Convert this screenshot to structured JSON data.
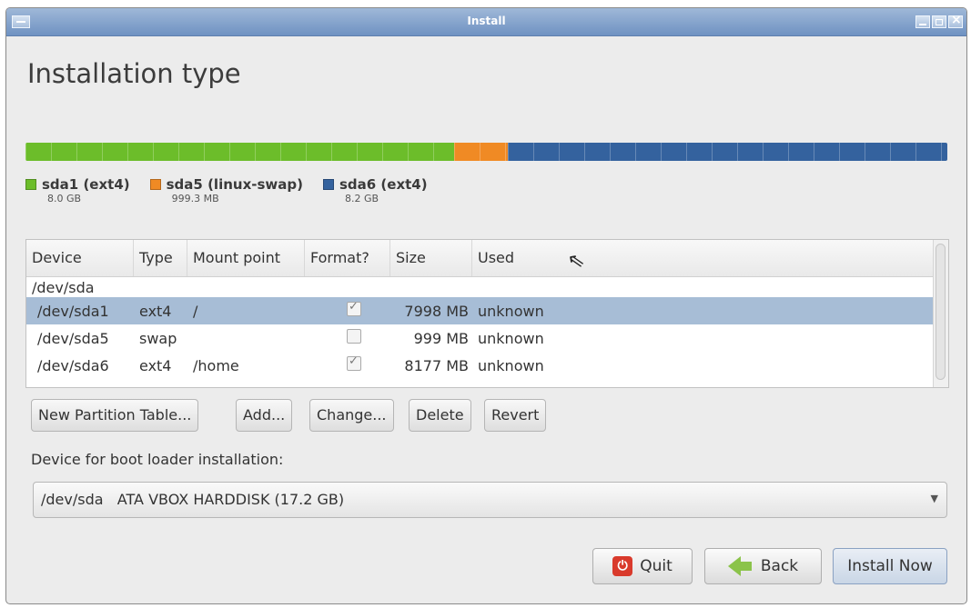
{
  "window": {
    "title": "Install"
  },
  "heading": "Installation type",
  "partition_bar": [
    {
      "name": "sda1 (ext4)",
      "fraction": 0.465,
      "color": "#6cbd2a"
    },
    {
      "name": "sda5 (linux-swap)",
      "fraction": 0.058,
      "color": "#f08a24"
    },
    {
      "name": "sda6 (ext4)",
      "fraction": 0.477,
      "color": "#34629e"
    }
  ],
  "legend": [
    {
      "name": "sda1 (ext4)",
      "size": "8.0 GB",
      "color": "#6cbd2a"
    },
    {
      "name": "sda5 (linux-swap)",
      "size": "999.3 MB",
      "color": "#f08a24"
    },
    {
      "name": "sda6 (ext4)",
      "size": "8.2 GB",
      "color": "#34629e"
    }
  ],
  "table": {
    "headers": [
      "Device",
      "Type",
      "Mount point",
      "Format?",
      "Size",
      "Used"
    ],
    "parent": "/dev/sda",
    "rows": [
      {
        "device": "/dev/sda1",
        "type": "ext4",
        "mount": "/",
        "format": true,
        "size": "7998 MB",
        "used": "unknown",
        "selected": true
      },
      {
        "device": "/dev/sda5",
        "type": "swap",
        "mount": "",
        "format": false,
        "size": "999 MB",
        "used": "unknown",
        "selected": false
      },
      {
        "device": "/dev/sda6",
        "type": "ext4",
        "mount": "/home",
        "format": true,
        "size": "8177 MB",
        "used": "unknown",
        "selected": false
      }
    ]
  },
  "actions": {
    "new_table": "New Partition Table...",
    "add": "Add...",
    "change": "Change...",
    "delete": "Delete",
    "revert": "Revert"
  },
  "boot": {
    "label": "Device for boot loader installation:",
    "value": "/dev/sda   ATA VBOX HARDDISK (17.2 GB)"
  },
  "footer": {
    "quit": "Quit",
    "back": "Back",
    "install": "Install Now"
  },
  "icons": {
    "quit": "power-icon",
    "back": "back-arrow-icon",
    "dropdown": "chevron-down-icon"
  }
}
